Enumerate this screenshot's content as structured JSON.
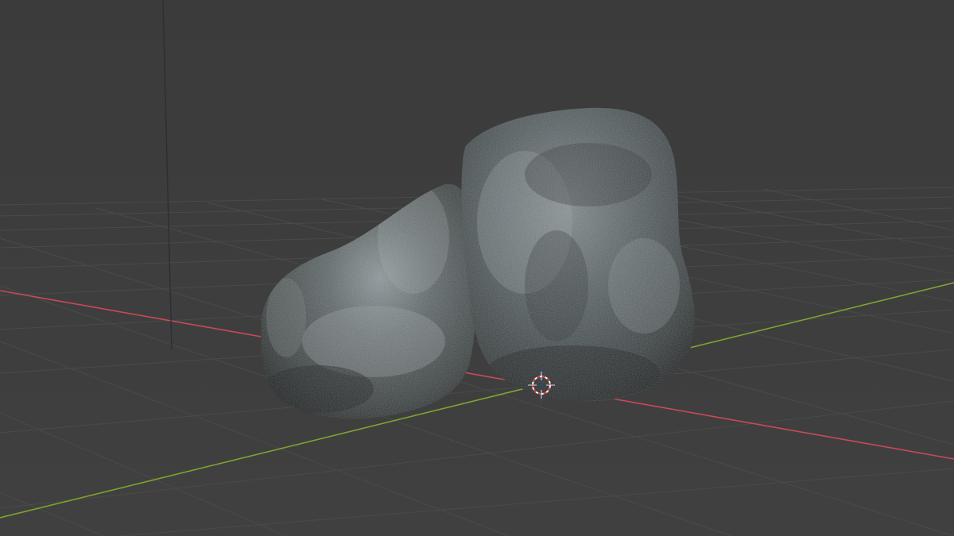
{
  "app": {
    "view": "3D Viewport"
  },
  "scene": {
    "background_color": "#3d3d3d",
    "grid_color": "#4a4a4a",
    "x_axis_color": "#c94a55",
    "y_axis_color": "#7ea42f",
    "z_axis_color": "#3f5f8f",
    "objects": [
      {
        "name": "rock-left",
        "kind": "rock"
      },
      {
        "name": "rock-right",
        "kind": "rock"
      }
    ],
    "cursor": {
      "name": "3d-cursor"
    }
  }
}
